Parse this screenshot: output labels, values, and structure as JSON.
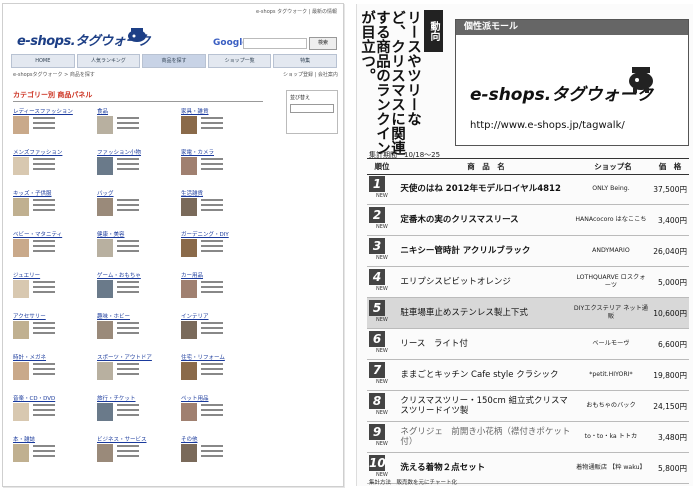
{
  "web": {
    "top_links": "e-shops タグウォーク | 最新の情報",
    "logo": "e-shops.タグウォーク",
    "google": "Google",
    "search_button": "検索",
    "nav": [
      "HOME",
      "人気ランキング",
      "商品を探す",
      "ショップ一覧",
      "特集"
    ],
    "breadcrumb": "e-shopsタグウォーク > 商品を探す",
    "breadcrumb_right": "ショップ登録 | 会社案内",
    "section_title": "カテゴリー別 商品パネル",
    "side_title": "並び替え",
    "categories": [
      "レディースファッション",
      "食品",
      "家具・雑貨",
      "メンズファッション",
      "ファッション小物",
      "家電・カメラ",
      "キッズ・子供服",
      "バッグ",
      "生活雑貨",
      "ベビー・マタニティ",
      "健康・美容",
      "ガーデニング・DIY",
      "ジュエリー",
      "ゲーム・おもちゃ",
      "カー用品",
      "アクセサリー",
      "趣味・ホビー",
      "インテリア",
      "時計・メガネ",
      "スポーツ・アウトドア",
      "住宅・リフォーム",
      "音楽・CD・DVD",
      "旅行・チケット",
      "ペット用品",
      "本・雑誌",
      "ビジネス・サービス",
      "その他"
    ]
  },
  "mag": {
    "vertical_text": [
      "リースやツリーな",
      "ど、クリスマスに関連",
      "する商品のランクイン",
      "が目立つ。"
    ],
    "badge": "動向",
    "mall_header": "個性派モール",
    "mall_logo": "e-shops.タグウォーク",
    "mall_url": "http://www.e-shops.jp/tagwalk/",
    "period": "集計期間　10/18〜25",
    "headers": {
      "rank": "順位",
      "product": "商　品　名",
      "shop": "ショップ名",
      "price": "価　格"
    },
    "new_label": "NEW",
    "footnote": "集計方法　販売数を元にチャート化",
    "rows": [
      {
        "rank": "1",
        "name": "天使のはね 2012年モデルロイヤル4812",
        "shop": "ONLY Being.",
        "price": "37,500円",
        "bold": true
      },
      {
        "rank": "2",
        "name": "定番木の実のクリスマスリース",
        "shop": "HANAcocoro はなここち",
        "price": "3,400円",
        "bold": true
      },
      {
        "rank": "3",
        "name": "ニキシー管時計 アクリルブラック",
        "shop": "ANDYMARIO",
        "price": "26,040円",
        "bold": true
      },
      {
        "rank": "4",
        "name": "エリプシスピビットオレンジ",
        "shop": "LOTHQUARVE ロスクォーツ",
        "price": "5,000円",
        "bold": false
      },
      {
        "rank": "5",
        "name": "駐車場車止めステンレス製上下式",
        "shop": "DIYエクステリア ネット通販",
        "price": "10,600円",
        "bold": false,
        "highlight": true
      },
      {
        "rank": "6",
        "name": "リース　ライト付",
        "shop": "ベールモーヴ",
        "price": "6,600円",
        "bold": false
      },
      {
        "rank": "7",
        "name": "ままごとキッチン Cafe style クラシック",
        "shop": "*petit.HIYORI*",
        "price": "19,800円",
        "bold": false
      },
      {
        "rank": "8",
        "name": "クリスマスツリー・150cm 組立式クリスマスツリードイツ製",
        "shop": "おもちゃのバック",
        "price": "24,150円",
        "bold": false
      },
      {
        "rank": "9",
        "name": "ネグリジェ　前開き小花柄（襟付きポケット付）",
        "shop": "to・to・ka トトカ",
        "price": "3,480円",
        "bold": false,
        "faint": true
      },
      {
        "rank": "10",
        "name": "洗える着物２点セット",
        "shop": "着物通販店 【粋 waku】",
        "price": "5,800円",
        "bold": true
      }
    ]
  }
}
